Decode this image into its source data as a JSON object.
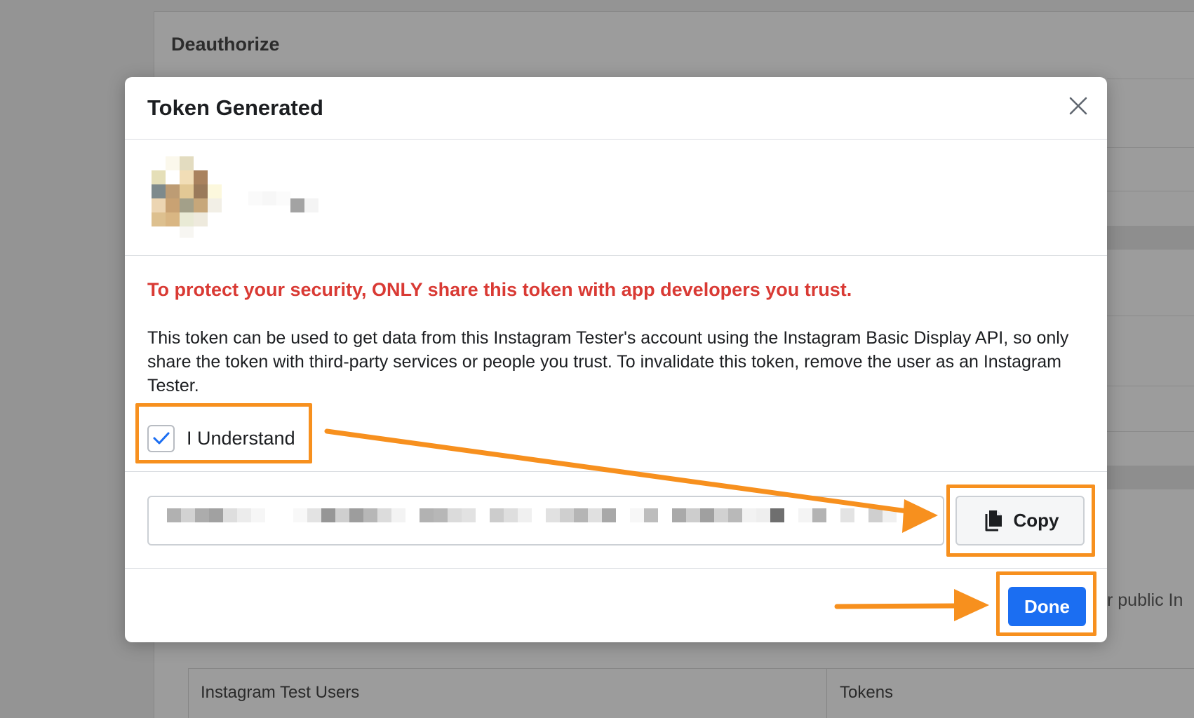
{
  "background": {
    "title": "Deauthorize",
    "side_text": "r public In",
    "table": {
      "headers": [
        "Instagram Test Users",
        "Tokens"
      ]
    }
  },
  "modal": {
    "title": "Token Generated",
    "close_icon": "close-icon",
    "warning": "To protect your security, ONLY share this token with app developers you trust.",
    "description": "This token can be used to get data from this Instagram Tester's account using the Instagram Basic Display API, so only share the token with third-party services or people you trust. To invalidate this token, remove the user as an Instagram Tester.",
    "understand": {
      "label": "I Understand",
      "checked": true
    },
    "copy_button": {
      "label": "Copy",
      "icon": "copy-icon"
    },
    "done_button": {
      "label": "Done"
    }
  },
  "colors": {
    "warning": "#d93a34",
    "primary": "#1b6ef2",
    "annotation": "#f7901e",
    "overlay": "#949494"
  }
}
